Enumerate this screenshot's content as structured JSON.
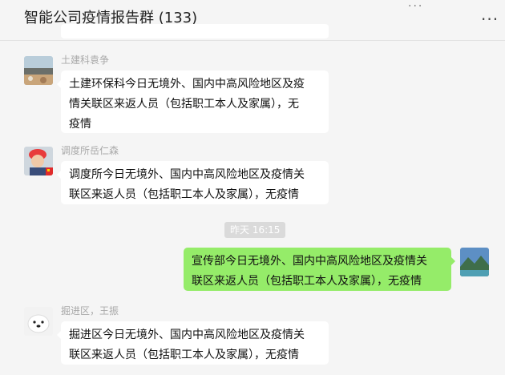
{
  "window": {
    "title": "智能公司疫情报告群 (133)",
    "more_icon": "more-icon",
    "window_controls": "..."
  },
  "messages": [
    {
      "sender": "土建科袁争",
      "lines": [
        "土建环保科今日无境外、国内中高风险地区及疫",
        "情关联区来返人员（包括职工本人及家属），无",
        "疫情"
      ]
    },
    {
      "sender": "调度所岳仁森",
      "lines": [
        "调度所今日无境外、国内中高风险地区及疫情关",
        "联区来返人员（包括职工本人及家属），无疫情"
      ]
    },
    {
      "sender": "",
      "mine": true,
      "lines": [
        "宣传部今日无境外、国内中高风险地区及疫情关",
        "联区来返人员（包括职工本人及家属），无疫情"
      ]
    },
    {
      "sender": "掘进区，王振",
      "lines": [
        "掘进区今日无境外、国内中高风险地区及疫情关",
        "联区来返人员（包括职工本人及家属），无疫情"
      ]
    }
  ],
  "timestamp": "昨天 16:15",
  "colors": {
    "background": "#f5f5f5",
    "bubble_other": "#ffffff",
    "bubble_mine": "#95ec69",
    "time_badge": "#dadada"
  }
}
